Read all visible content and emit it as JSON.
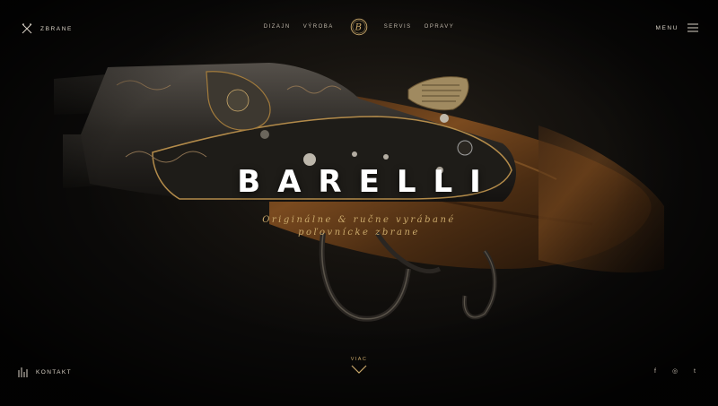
{
  "brand": {
    "left_label": "ZBRANE"
  },
  "nav": {
    "items": [
      {
        "label": "DIZAJN"
      },
      {
        "label": "VÝROBA"
      },
      {
        "label": "SERVIS"
      },
      {
        "label": "OPRAVY"
      }
    ],
    "logo_letter": "B"
  },
  "menu": {
    "label": "MENU"
  },
  "hero": {
    "title": "BARELLI",
    "subtitle_line1": "Originálne & ručne vyrábané",
    "subtitle_line2": "poľovnícke zbrane"
  },
  "scroll": {
    "label": "VIAC"
  },
  "contact": {
    "label": "KONTAKT"
  },
  "socials": [
    {
      "icon": "facebook-icon",
      "glyph": "f"
    },
    {
      "icon": "instagram-icon",
      "glyph": "◎"
    },
    {
      "icon": "twitter-icon",
      "glyph": "t"
    }
  ],
  "colors": {
    "gold": "#c9a86a",
    "background": "#0b0a09",
    "text": "#d9d2c6"
  }
}
